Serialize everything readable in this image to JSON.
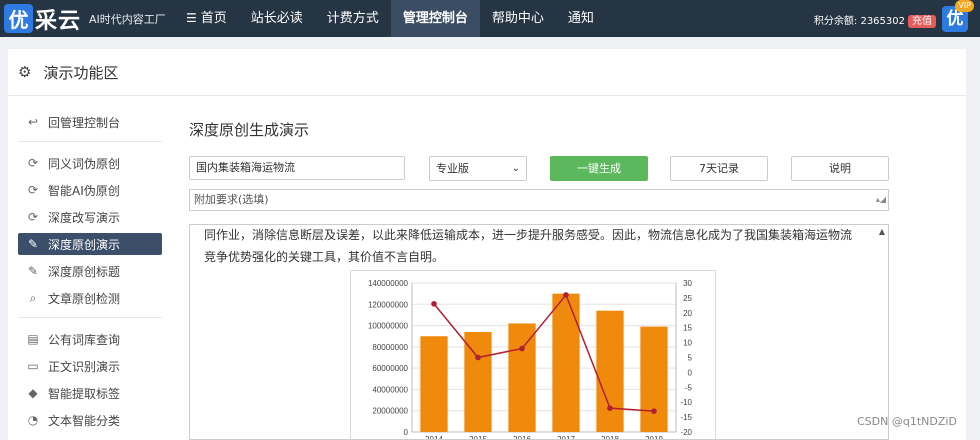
{
  "topbar": {
    "logo_mark": "优",
    "logo_name": "采云",
    "logo_tag": "AI时代内容工厂",
    "nav": [
      {
        "label": "首页",
        "icon": "menu-icon"
      },
      {
        "label": "站长必读"
      },
      {
        "label": "计费方式"
      },
      {
        "label": "管理控制台",
        "active": true
      },
      {
        "label": "帮助中心"
      },
      {
        "label": "通知"
      }
    ],
    "score_label": "积分余额: 2365302",
    "recharge": "充值",
    "vip_mark": "优",
    "vip_badge": "VIP"
  },
  "panel": {
    "title": "演示功能区",
    "icon": "gear-icon"
  },
  "sidebar": {
    "groups": [
      [
        {
          "label": "回管理控制台",
          "icon": "back-arrow-icon"
        }
      ],
      [
        {
          "label": "同义词伪原创",
          "icon": "refresh-icon"
        },
        {
          "label": "智能AI伪原创",
          "icon": "refresh-icon"
        },
        {
          "label": "深度改写演示",
          "icon": "refresh-icon"
        },
        {
          "label": "深度原创演示",
          "icon": "edit-icon",
          "active": true
        },
        {
          "label": "深度原创标题",
          "icon": "edit-icon"
        },
        {
          "label": "文章原创检测",
          "icon": "search-icon"
        }
      ],
      [
        {
          "label": "公有词库查询",
          "icon": "book-icon"
        },
        {
          "label": "正文识别演示",
          "icon": "monitor-icon"
        },
        {
          "label": "智能提取标签",
          "icon": "tag-icon"
        },
        {
          "label": "文本智能分类",
          "icon": "pie-icon"
        }
      ]
    ]
  },
  "main": {
    "title": "深度原创生成演示",
    "topic_value": "国内集装箱海运物流",
    "version": "专业版",
    "generate": "一键生成",
    "history": "7天记录",
    "help": "说明",
    "extra_placeholder": "附加要求(选填)",
    "output_text": "同作业，消除信息断层及误差，以此来降低运输成本，进一步提升服务感受。因此，物流信息化成为了我国集装箱海运物流竞争优势强化的关键工具，其价值不言自明。"
  },
  "chart_data": {
    "type": "bar",
    "categories": [
      "2014",
      "2015",
      "2016",
      "2017",
      "2018",
      "2019"
    ],
    "series": [
      {
        "type": "bar",
        "values": [
          90000000,
          94000000,
          102000000,
          130000000,
          114000000,
          99000000
        ],
        "color": "#f08a0c"
      },
      {
        "type": "line",
        "axis": "right",
        "values": [
          23,
          5,
          8,
          26,
          -12,
          -13
        ],
        "color": "#b02030"
      }
    ],
    "y_ticks": [
      "140000000",
      "120000000",
      "100000000",
      "80000000",
      "60000000",
      "40000000",
      "20000000",
      "0"
    ],
    "y2_ticks": [
      "30",
      "25",
      "20",
      "15",
      "10",
      "5",
      "0",
      "-5",
      "-10",
      "-15",
      "-20"
    ],
    "ylim": [
      0,
      140000000
    ],
    "y2lim": [
      -20,
      30
    ],
    "grid": true
  },
  "watermark": "CSDN @q1tNDZiD"
}
